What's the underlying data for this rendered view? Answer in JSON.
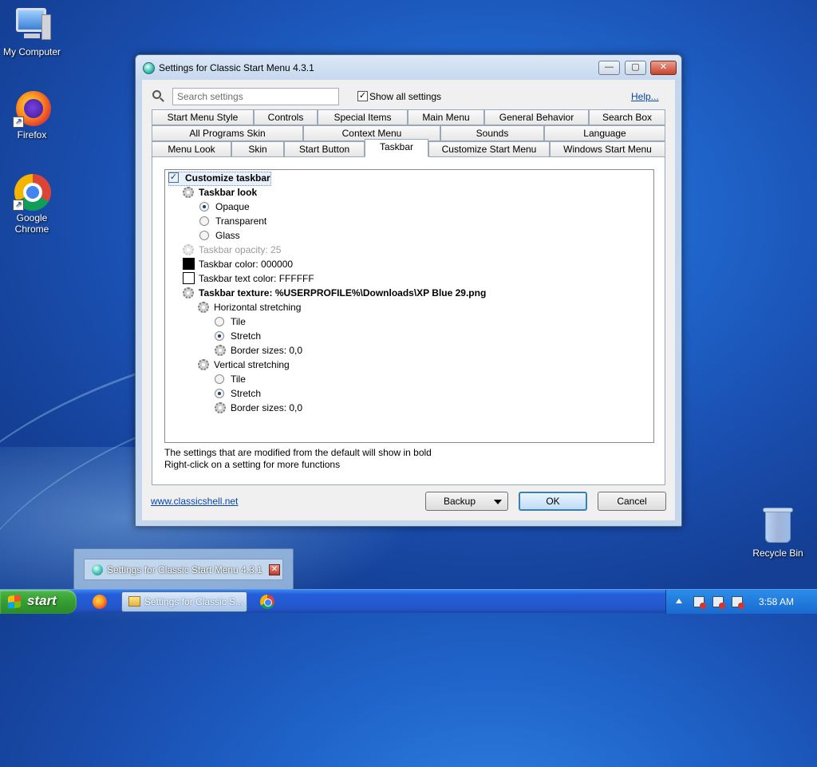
{
  "desktop": {
    "icons": [
      {
        "label": "My Computer"
      },
      {
        "label": "Firefox"
      },
      {
        "label": "Google Chrome"
      },
      {
        "label": "Recycle Bin"
      }
    ]
  },
  "window": {
    "title": "Settings for Classic Start Menu 4.3.1",
    "minimize_glyph": "—",
    "maximize_glyph": "▢",
    "close_glyph": "✕",
    "search": {
      "placeholder": "Search settings",
      "value": ""
    },
    "show_all": {
      "label": "Show all settings",
      "checked": true,
      "check_glyph": "✓"
    },
    "help_link": "Help...",
    "tabs": {
      "row1": [
        "Start Menu Style",
        "Controls",
        "Special Items",
        "Main Menu",
        "General Behavior",
        "Search Box"
      ],
      "row2": [
        "All Programs Skin",
        "Context Menu",
        "Sounds",
        "Language"
      ],
      "row3": [
        "Menu Look",
        "Skin",
        "Start Button",
        "Taskbar",
        "Customize Start Menu",
        "Windows Start Menu"
      ],
      "active": "Taskbar"
    },
    "tree": [
      {
        "label": "Customize taskbar",
        "kind": "checkbox",
        "checked": true,
        "bold": true
      },
      {
        "label": "Taskbar look",
        "kind": "gear",
        "bold": true
      },
      {
        "label": "Opaque",
        "kind": "radio",
        "selected": true
      },
      {
        "label": "Transparent",
        "kind": "radio",
        "selected": false
      },
      {
        "label": "Glass",
        "kind": "radio",
        "selected": false
      },
      {
        "label": "Taskbar opacity: 25",
        "kind": "gear",
        "dim": true
      },
      {
        "label": "Taskbar color: 000000",
        "kind": "swatch",
        "color": "#000000"
      },
      {
        "label": "Taskbar text color: FFFFFF",
        "kind": "swatch",
        "color": "#FFFFFF"
      },
      {
        "label": "Taskbar texture: %USERPROFILE%\\Downloads\\XP Blue 29.png",
        "kind": "gear",
        "bold": true
      },
      {
        "label": "Horizontal stretching",
        "kind": "gear"
      },
      {
        "label": "Tile",
        "kind": "radio",
        "selected": false
      },
      {
        "label": "Stretch",
        "kind": "radio",
        "selected": true
      },
      {
        "label": "Border sizes: 0,0",
        "kind": "gear"
      },
      {
        "label": "Vertical stretching",
        "kind": "gear"
      },
      {
        "label": "Tile",
        "kind": "radio",
        "selected": false
      },
      {
        "label": "Stretch",
        "kind": "radio",
        "selected": true
      },
      {
        "label": "Border sizes: 0,0",
        "kind": "gear"
      }
    ],
    "info_line1": "The settings that are modified from the default will show in bold",
    "info_line2": "Right-click on a setting for more functions",
    "site_link": "www.classicshell.net",
    "buttons": {
      "backup": "Backup",
      "ok": "OK",
      "cancel": "Cancel"
    }
  },
  "thumbnail": {
    "title": "Settings for Classic Start Menu 4.3.1",
    "close_glyph": "✕"
  },
  "taskbar": {
    "start_label": "start",
    "active_task_label": "Settings for Classic S...",
    "clock": "3:58 AM"
  },
  "colors": {
    "desktop_blue": "#1f63c9",
    "taskbar_blue": "#245edb",
    "start_green": "#37a033",
    "link_blue": "#0645ad"
  }
}
